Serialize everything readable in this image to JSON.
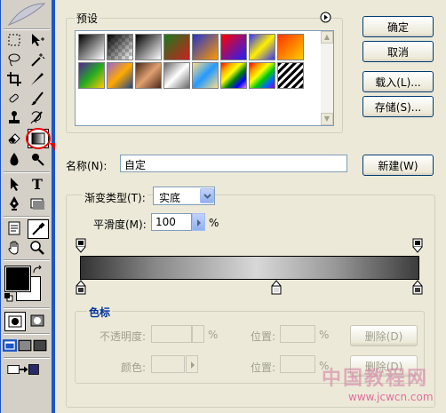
{
  "presets": {
    "label": "预设",
    "menu_icon": "right-arrow-circle-icon",
    "swatches": [
      "linear-gradient(135deg,#000,#fff)",
      "linear-gradient(135deg,#000 0%,rgba(0,0,0,0) 100%)",
      "linear-gradient(135deg,#000,#fff)",
      "linear-gradient(135deg,#1a7a1a,#cc2020)",
      "linear-gradient(135deg,#2233cc,#ff9900)",
      "linear-gradient(135deg,#ff0000,#2020ff)",
      "linear-gradient(135deg,#3333ff,#ffee00,#3333ff)",
      "linear-gradient(135deg,#ff3300,#ffcc00)",
      "linear-gradient(135deg,#552299,#22aa22,#ffcc00)",
      "linear-gradient(135deg,#9966cc,#ffaa00,#224488)",
      "linear-gradient(135deg,#4a2a1a,#e0a070,#4a2a1a)",
      "linear-gradient(135deg,#666,#fff,#666)",
      "linear-gradient(135deg,#ffdd88,#2299ff,#ffdd88)",
      "linear-gradient(135deg,red,orange,yellow,green,blue,violet)",
      "linear-gradient(135deg,#ff0000,#ff9900,#ffff00,#00cc00,#0066ff,#9900cc)",
      "repeating-linear-gradient(135deg,#000 0 3px,#fff 3px 6px)"
    ]
  },
  "buttons": {
    "ok": "确定",
    "cancel": "取消",
    "load": "载入(L)...",
    "save": "存储(S)...",
    "new": "新建(W)",
    "delete1": "删除(D)",
    "delete2": "删除(D)"
  },
  "name": {
    "label": "名称(N):",
    "value": "自定"
  },
  "gradient": {
    "type_label": "渐变类型(T):",
    "type_value": "实底",
    "smooth_label": "平滑度(M):",
    "smooth_value": "100",
    "smooth_unit": "%"
  },
  "colorstop": {
    "group_label": "色标",
    "opacity_label": "不透明度:",
    "opacity_unit": "%",
    "position_label1": "位置:",
    "position_unit1": "%",
    "color_label": "颜色:",
    "position_label2": "位置:",
    "position_unit2": "%"
  },
  "watermark": {
    "line1": "中国教程网",
    "line2": "www.jcwcn.com"
  }
}
